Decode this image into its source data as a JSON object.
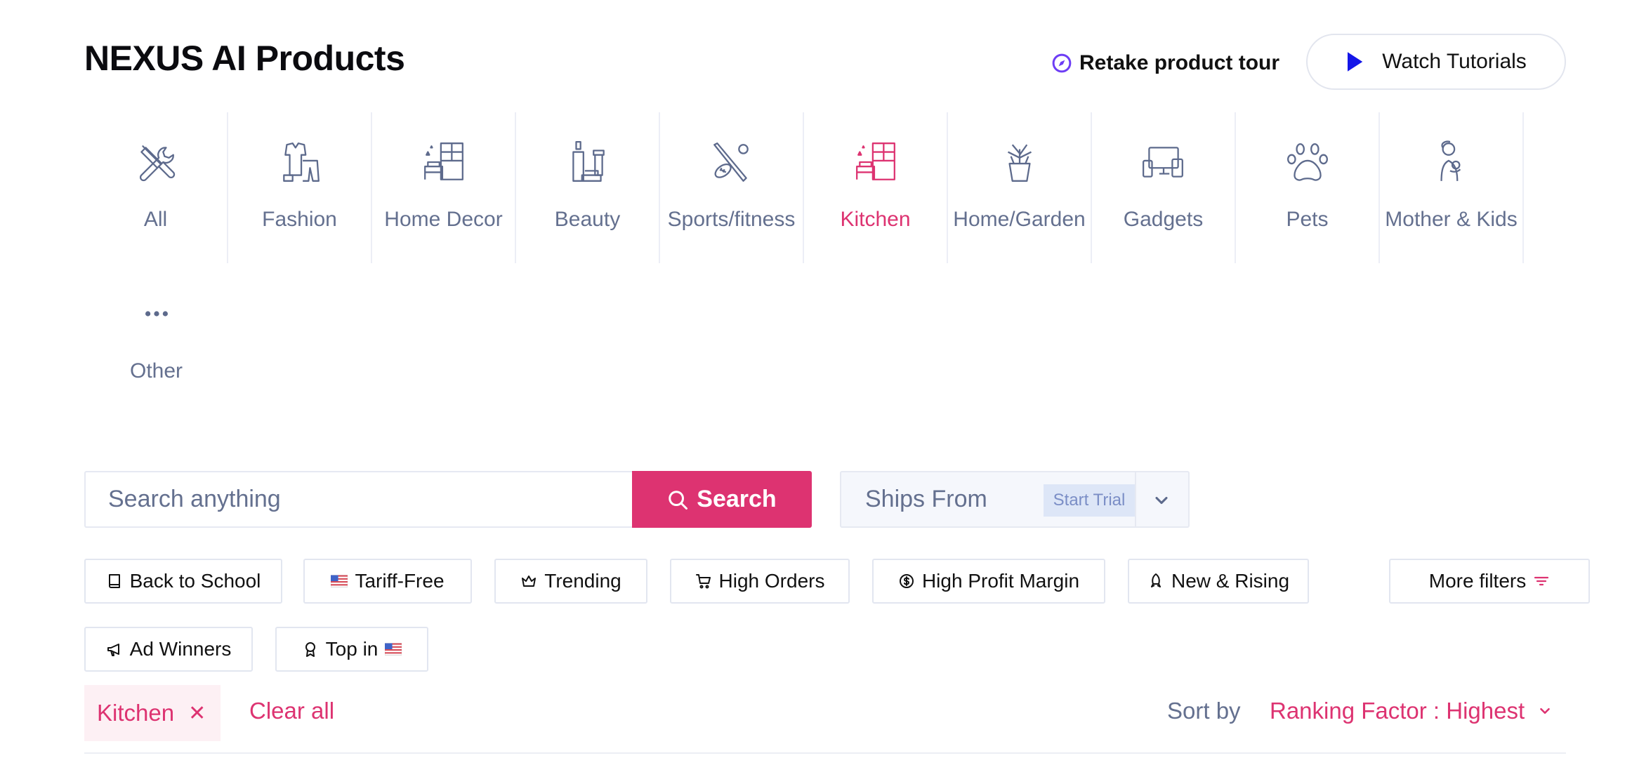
{
  "header": {
    "title": "NEXUS AI Products",
    "tour_label": "Retake product tour",
    "tutorials_label": "Watch Tutorials"
  },
  "categories": [
    {
      "label": "All",
      "icon": "tools-icon"
    },
    {
      "label": "Fashion",
      "icon": "clothing-icon"
    },
    {
      "label": "Home Decor",
      "icon": "bedroom-icon"
    },
    {
      "label": "Beauty",
      "icon": "cosmetics-icon"
    },
    {
      "label": "Sports/fitness",
      "icon": "sports-icon"
    },
    {
      "label": "Kitchen",
      "icon": "kitchen-icon",
      "active": true
    },
    {
      "label": "Home/Garden",
      "icon": "plant-icon"
    },
    {
      "label": "Gadgets",
      "icon": "devices-icon"
    },
    {
      "label": "Pets",
      "icon": "paw-icon"
    },
    {
      "label": "Mother & Kids",
      "icon": "mother-child-icon"
    },
    {
      "label": "Other",
      "icon": "more-dots-icon"
    }
  ],
  "search": {
    "placeholder": "Search anything",
    "button_label": "Search"
  },
  "ships_from": {
    "label": "Ships From",
    "badge": "Start Trial"
  },
  "filters": {
    "back_to_school": "Back to School",
    "tariff_free": "Tariff-Free",
    "trending": "Trending",
    "high_orders": "High Orders",
    "high_profit_margin": "High Profit Margin",
    "new_rising": "New & Rising",
    "more_filters": "More filters",
    "ad_winners": "Ad Winners",
    "top_in": "Top in"
  },
  "active_filters": {
    "tag": "Kitchen",
    "remove_glyph": "✕",
    "clear_all": "Clear all"
  },
  "sort": {
    "label": "Sort by",
    "value": "Ranking Factor : Highest"
  },
  "colors": {
    "accent": "#dd3371",
    "muted_text": "#64708f",
    "tour_icon": "#6d3df5",
    "play_icon": "#1416e8"
  }
}
